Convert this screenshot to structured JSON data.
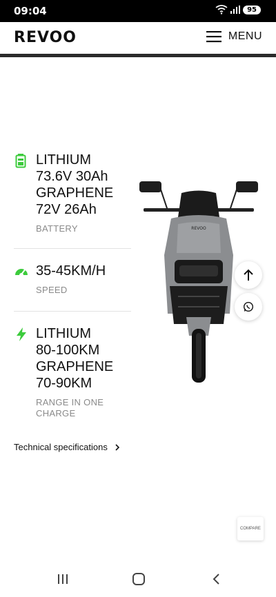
{
  "status": {
    "time": "09:04",
    "battery": "95"
  },
  "header": {
    "logo": "REVOO",
    "menu_label": "MENU"
  },
  "specs": [
    {
      "value_lines": [
        "LITHIUM",
        "73.6V 30Ah",
        "GRAPHENE",
        "72V 26Ah"
      ],
      "caption": "BATTERY",
      "icon": "battery-icon"
    },
    {
      "value_lines": [
        "35-45KM/H"
      ],
      "caption": "SPEED",
      "icon": "speedometer-icon"
    },
    {
      "value_lines": [
        "LITHIUM",
        "80-100KM",
        "GRAPHENE",
        "70-90KM"
      ],
      "caption_lines": [
        "RANGE IN ONE",
        "CHARGE"
      ],
      "icon": "lightning-icon"
    }
  ],
  "tech_link": "Technical specifications",
  "compare_label": "COMPARE",
  "colors": {
    "accent": "#3ccb3c",
    "dark": "#111111"
  }
}
